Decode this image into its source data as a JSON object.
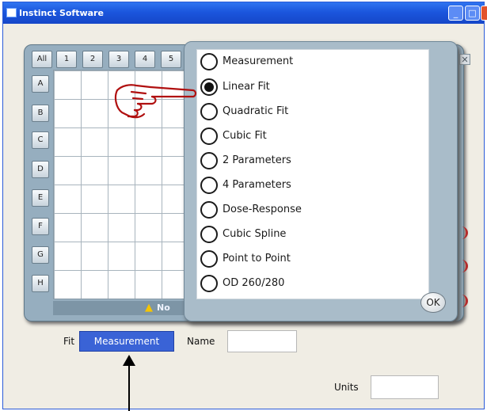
{
  "window": {
    "title": "Instinct Software"
  },
  "plate": {
    "all_label": "All",
    "columns": [
      "1",
      "2",
      "3",
      "4",
      "5"
    ],
    "rows": [
      "A",
      "B",
      "C",
      "D",
      "E",
      "F",
      "G",
      "H"
    ],
    "warning_text": "No"
  },
  "fit_popup": {
    "options": [
      {
        "label": "Measurement",
        "selected": false
      },
      {
        "label": "Linear Fit",
        "selected": true
      },
      {
        "label": "Quadratic Fit",
        "selected": false
      },
      {
        "label": "Cubic Fit",
        "selected": false
      },
      {
        "label": "2 Parameters",
        "selected": false
      },
      {
        "label": "4 Parameters",
        "selected": false
      },
      {
        "label": "Dose-Response",
        "selected": false
      },
      {
        "label": "Cubic Spline",
        "selected": false
      },
      {
        "label": "Point to Point",
        "selected": false
      },
      {
        "label": "OD 260/280",
        "selected": false
      }
    ],
    "ok_label": "OK"
  },
  "form": {
    "fit_label": "Fit",
    "fit_value": "Measurement",
    "name_label": "Name",
    "name_value": "",
    "units_label": "Units",
    "units_value": ""
  },
  "colors": {
    "titlebar": "#1b56dd",
    "panel": "#96aebf",
    "fit_select": "#3a63d6",
    "pointer": "#b01010"
  },
  "icons": {
    "pointer": "hand-pointer-icon",
    "warning": "warning-icon",
    "arrow": "arrow-up-icon"
  }
}
